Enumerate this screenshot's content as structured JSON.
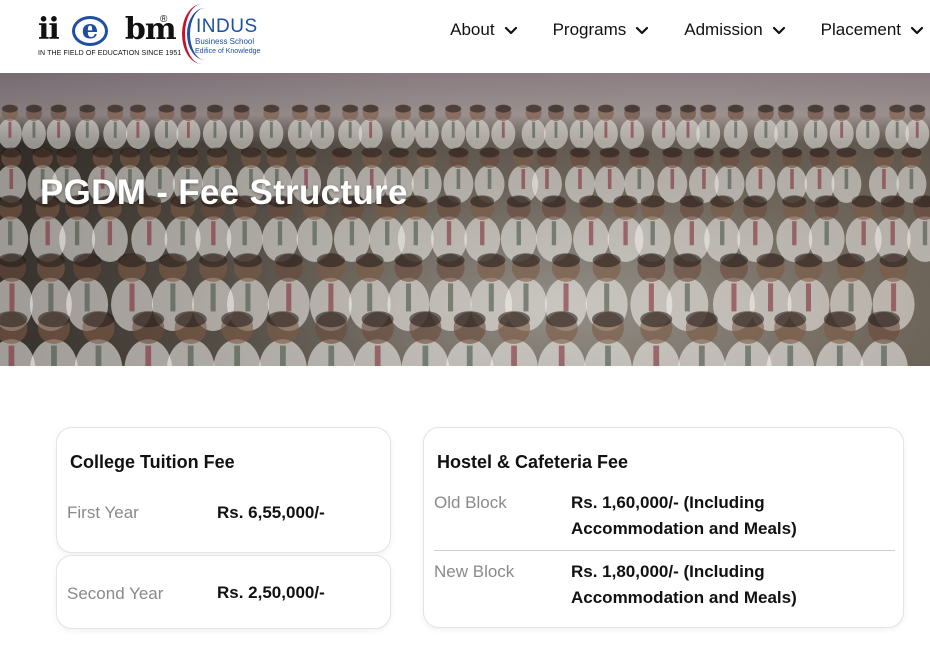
{
  "header": {
    "iiebm_logo": {
      "word": "iiebm",
      "registered": "®",
      "tagline": "IN THE FIELD OF EDUCATION SINCE 1951"
    },
    "indus_logo": {
      "name": "INDUS",
      "line1": "Business School",
      "line2": "Edifice of Knowledge"
    },
    "nav": [
      {
        "label": "About",
        "icon": "chevron-down-icon"
      },
      {
        "label": "Programs",
        "icon": "chevron-down-icon"
      },
      {
        "label": "Admission",
        "icon": "chevron-down-icon"
      },
      {
        "label": "Placement",
        "icon": "chevron-down-icon"
      }
    ]
  },
  "hero": {
    "title": "PGDM - Fee Structure",
    "background": "group-photo-of-students"
  },
  "tuition": {
    "title": "College Tuition Fee",
    "rows": [
      {
        "label": "First Year",
        "value": "Rs. 6,55,000/-"
      },
      {
        "label": "Second Year",
        "value": "Rs. 2,50,000/-"
      }
    ]
  },
  "hostel": {
    "title": "Hostel & Cafeteria Fee",
    "rows": [
      {
        "label": "Old Block",
        "value_line1": "Rs. 1,60,000/- (Including",
        "value_line2": "Accommodation and Meals)"
      },
      {
        "label": "New Block",
        "value_line1": "Rs. 1,80,000/- (Including",
        "value_line2": "Accommodation and Meals)"
      }
    ]
  },
  "colors": {
    "brand_blue": "#1e4fa3",
    "brand_red": "#c8102e",
    "label_grey": "#8a8a8a"
  }
}
